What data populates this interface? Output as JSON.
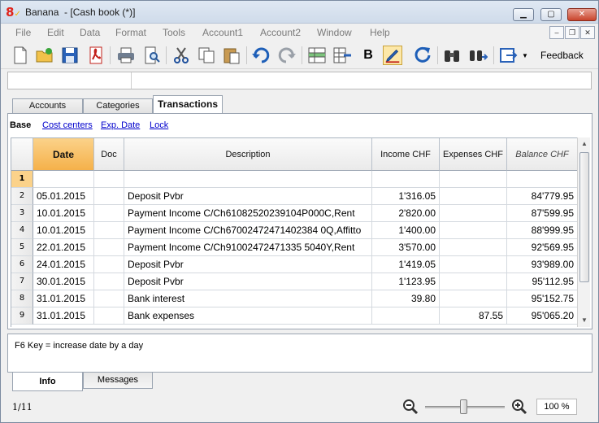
{
  "window": {
    "app_name": "Banana",
    "doc_title": "- [Cash book (*)]"
  },
  "menu": [
    "File",
    "Edit",
    "Data",
    "Format",
    "Tools",
    "Account1",
    "Account2",
    "Window",
    "Help"
  ],
  "toolbar": {
    "feedback_label": "Feedback",
    "bold_label": "B"
  },
  "tabs": [
    "Accounts",
    "Categories",
    "Transactions"
  ],
  "active_tab": "Transactions",
  "views": [
    "Base",
    "Cost centers",
    "Exp. Date",
    "Lock"
  ],
  "table": {
    "columns": [
      "Date",
      "Doc",
      "Description",
      "Income CHF",
      "Expenses CHF",
      "Balance CHF"
    ],
    "rows": [
      {
        "num": "1",
        "date": "",
        "doc": "",
        "desc": "",
        "income": "",
        "expenses": "",
        "balance": ""
      },
      {
        "num": "2",
        "date": "05.01.2015",
        "doc": "",
        "desc": "Deposit Pvbr",
        "income": "1'316.05",
        "expenses": "",
        "balance": "84'779.95"
      },
      {
        "num": "3",
        "date": "10.01.2015",
        "doc": "",
        "desc": "Payment Income C/Ch61082520239104P000C,Rent",
        "income": "2'820.00",
        "expenses": "",
        "balance": "87'599.95"
      },
      {
        "num": "4",
        "date": "10.01.2015",
        "doc": "",
        "desc": "Payment Income C/Ch67002472471402384 0Q,Affitto",
        "income": "1'400.00",
        "expenses": "",
        "balance": "88'999.95"
      },
      {
        "num": "5",
        "date": "22.01.2015",
        "doc": "",
        "desc": "Payment Income C/Ch91002472471335 5040Y,Rent",
        "income": "3'570.00",
        "expenses": "",
        "balance": "92'569.95"
      },
      {
        "num": "6",
        "date": "24.01.2015",
        "doc": "",
        "desc": "Deposit Pvbr",
        "income": "1'419.05",
        "expenses": "",
        "balance": "93'989.00"
      },
      {
        "num": "7",
        "date": "30.01.2015",
        "doc": "",
        "desc": "Deposit Pvbr",
        "income": "1'123.95",
        "expenses": "",
        "balance": "95'112.95"
      },
      {
        "num": "8",
        "date": "31.01.2015",
        "doc": "",
        "desc": "Bank interest",
        "income": "39.80",
        "expenses": "",
        "balance": "95'152.75"
      },
      {
        "num": "9",
        "date": "31.01.2015",
        "doc": "",
        "desc": "Bank expenses",
        "income": "",
        "expenses": "87.55",
        "balance": "95'065.20"
      }
    ]
  },
  "hint": "F6 Key = increase date by a day",
  "bottom_tabs": [
    "Info",
    "Messages"
  ],
  "status": {
    "row_position": "1/11",
    "zoom": "100 %",
    "zoom_fraction": 0.5
  }
}
